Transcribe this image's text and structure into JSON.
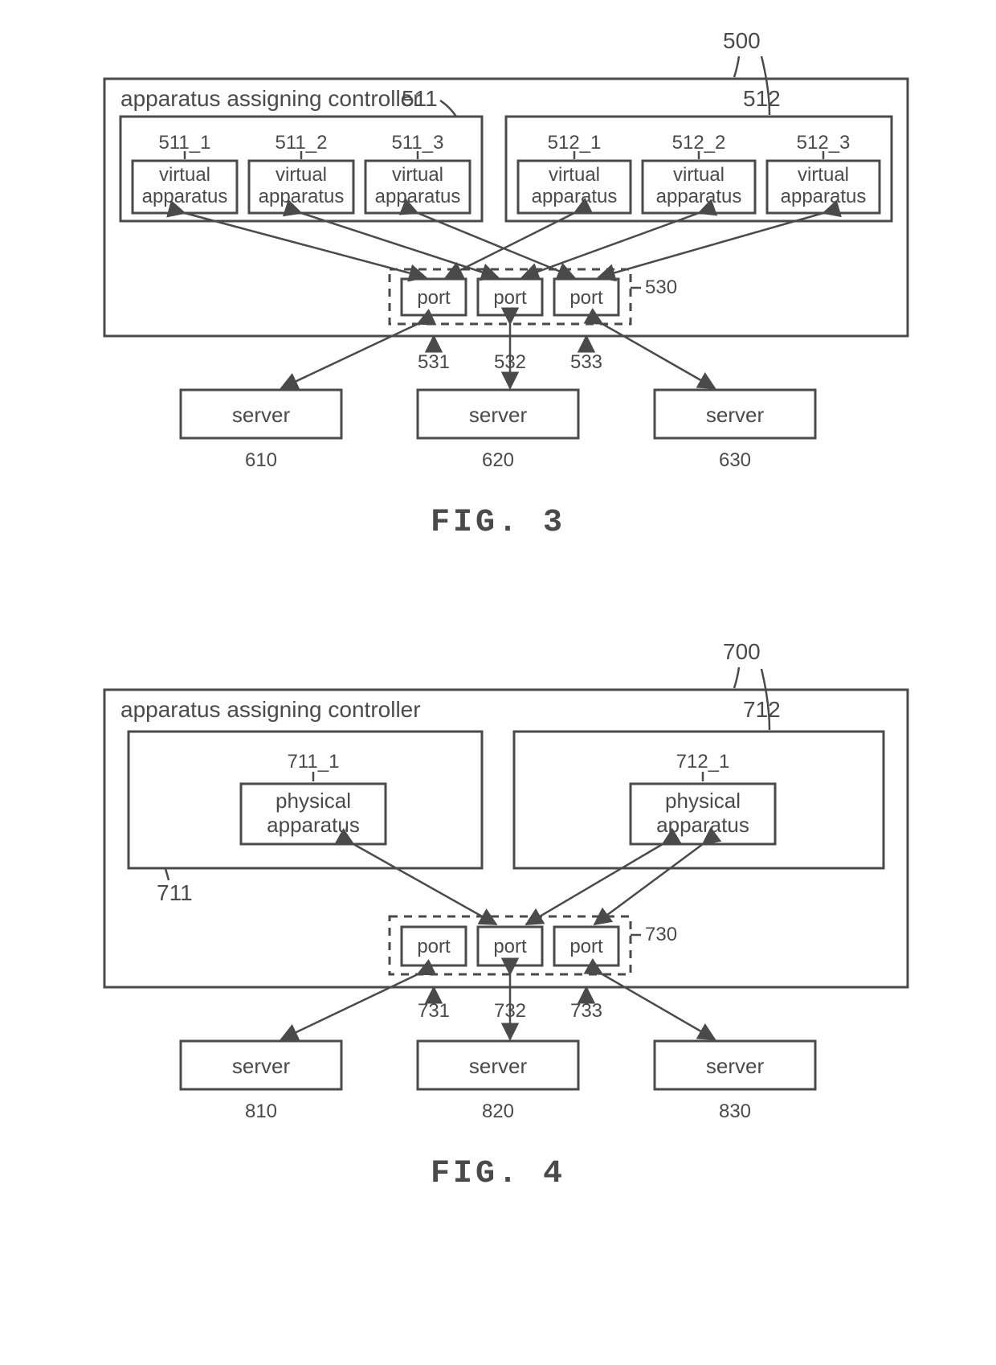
{
  "fig3": {
    "caption": "FIG. 3",
    "controller_ref": "500",
    "controller_label": "apparatus assigning controller",
    "group_left_ref": "511",
    "group_right_ref": "512",
    "va": {
      "l1": {
        "ref": "511_1",
        "text1": "virtual",
        "text2": "apparatus"
      },
      "l2": {
        "ref": "511_2",
        "text1": "virtual",
        "text2": "apparatus"
      },
      "l3": {
        "ref": "511_3",
        "text1": "virtual",
        "text2": "apparatus"
      },
      "r1": {
        "ref": "512_1",
        "text1": "virtual",
        "text2": "apparatus"
      },
      "r2": {
        "ref": "512_2",
        "text1": "virtual",
        "text2": "apparatus"
      },
      "r3": {
        "ref": "512_3",
        "text1": "virtual",
        "text2": "apparatus"
      }
    },
    "ports_ref": "530",
    "port1": {
      "label": "port",
      "ref": "531"
    },
    "port2": {
      "label": "port",
      "ref": "532"
    },
    "port3": {
      "label": "port",
      "ref": "533"
    },
    "server1": {
      "label": "server",
      "ref": "610"
    },
    "server2": {
      "label": "server",
      "ref": "620"
    },
    "server3": {
      "label": "server",
      "ref": "630"
    }
  },
  "fig4": {
    "caption": "FIG. 4",
    "controller_ref": "700",
    "controller_label": "apparatus assigning controller",
    "group_left_ref": "711",
    "group_right_ref": "712",
    "pa": {
      "l": {
        "ref": "711_1",
        "text1": "physical",
        "text2": "apparatus"
      },
      "r": {
        "ref": "712_1",
        "text1": "physical",
        "text2": "apparatus"
      }
    },
    "ports_ref": "730",
    "port1": {
      "label": "port",
      "ref": "731"
    },
    "port2": {
      "label": "port",
      "ref": "732"
    },
    "port3": {
      "label": "port",
      "ref": "733"
    },
    "server1": {
      "label": "server",
      "ref": "810"
    },
    "server2": {
      "label": "server",
      "ref": "820"
    },
    "server3": {
      "label": "server",
      "ref": "830"
    }
  }
}
